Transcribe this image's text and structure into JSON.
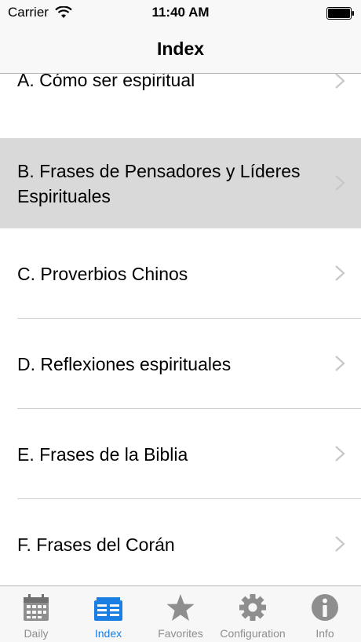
{
  "status": {
    "carrier": "Carrier",
    "time": "11:40 AM"
  },
  "nav": {
    "title": "Index"
  },
  "rows": [
    {
      "label": "A. Cómo ser espiritual"
    },
    {
      "label": "B. Frases de Pensadores y Líderes Espirituales"
    },
    {
      "label": "C. Proverbios Chinos"
    },
    {
      "label": "D. Reflexiones espirituales"
    },
    {
      "label": "E. Frases de la Biblia"
    },
    {
      "label": "F. Frases del Corán"
    }
  ],
  "selected_row": "B. Frases de Pensadores y Líderes Espirituales",
  "tabs": [
    {
      "label": "Daily",
      "icon": "calendar-icon"
    },
    {
      "label": "Index",
      "icon": "index-icon"
    },
    {
      "label": "Favorites",
      "icon": "star-icon"
    },
    {
      "label": "Configuration",
      "icon": "gear-icon"
    },
    {
      "label": "Info",
      "icon": "info-icon"
    }
  ],
  "active_tab": "Index",
  "colors": {
    "accent": "#1a7ee3",
    "inactive": "#8e8e8e",
    "highlight": "#d9d9d9"
  }
}
